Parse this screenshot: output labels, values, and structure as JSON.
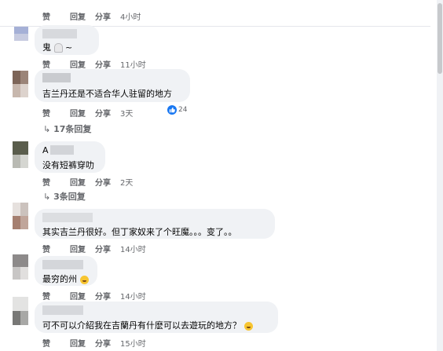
{
  "actions": {
    "like": "赞",
    "reply": "回复",
    "share": "分享"
  },
  "comments": [
    {
      "text": "",
      "time": "4小时"
    },
    {
      "text": "鬼",
      "suffix": "~",
      "time": "11小时"
    },
    {
      "text": "吉兰丹还是不适合华人驻留的地方",
      "time": "3天",
      "reactions": "24",
      "replies": "17条回复"
    },
    {
      "name_fragment": "A",
      "text": "没有短裤穿叻",
      "time": "2天",
      "replies": "3条回复"
    },
    {
      "text": "其实吉兰丹很好。但丁家奴来了个旺魔。。。变了。。",
      "time": "14小时"
    },
    {
      "text": "最穷的州",
      "time": "14小时"
    },
    {
      "text": "可不可以介紹我在吉蘭丹有什麽可以去遊玩的地方？",
      "time": "15小时"
    }
  ]
}
